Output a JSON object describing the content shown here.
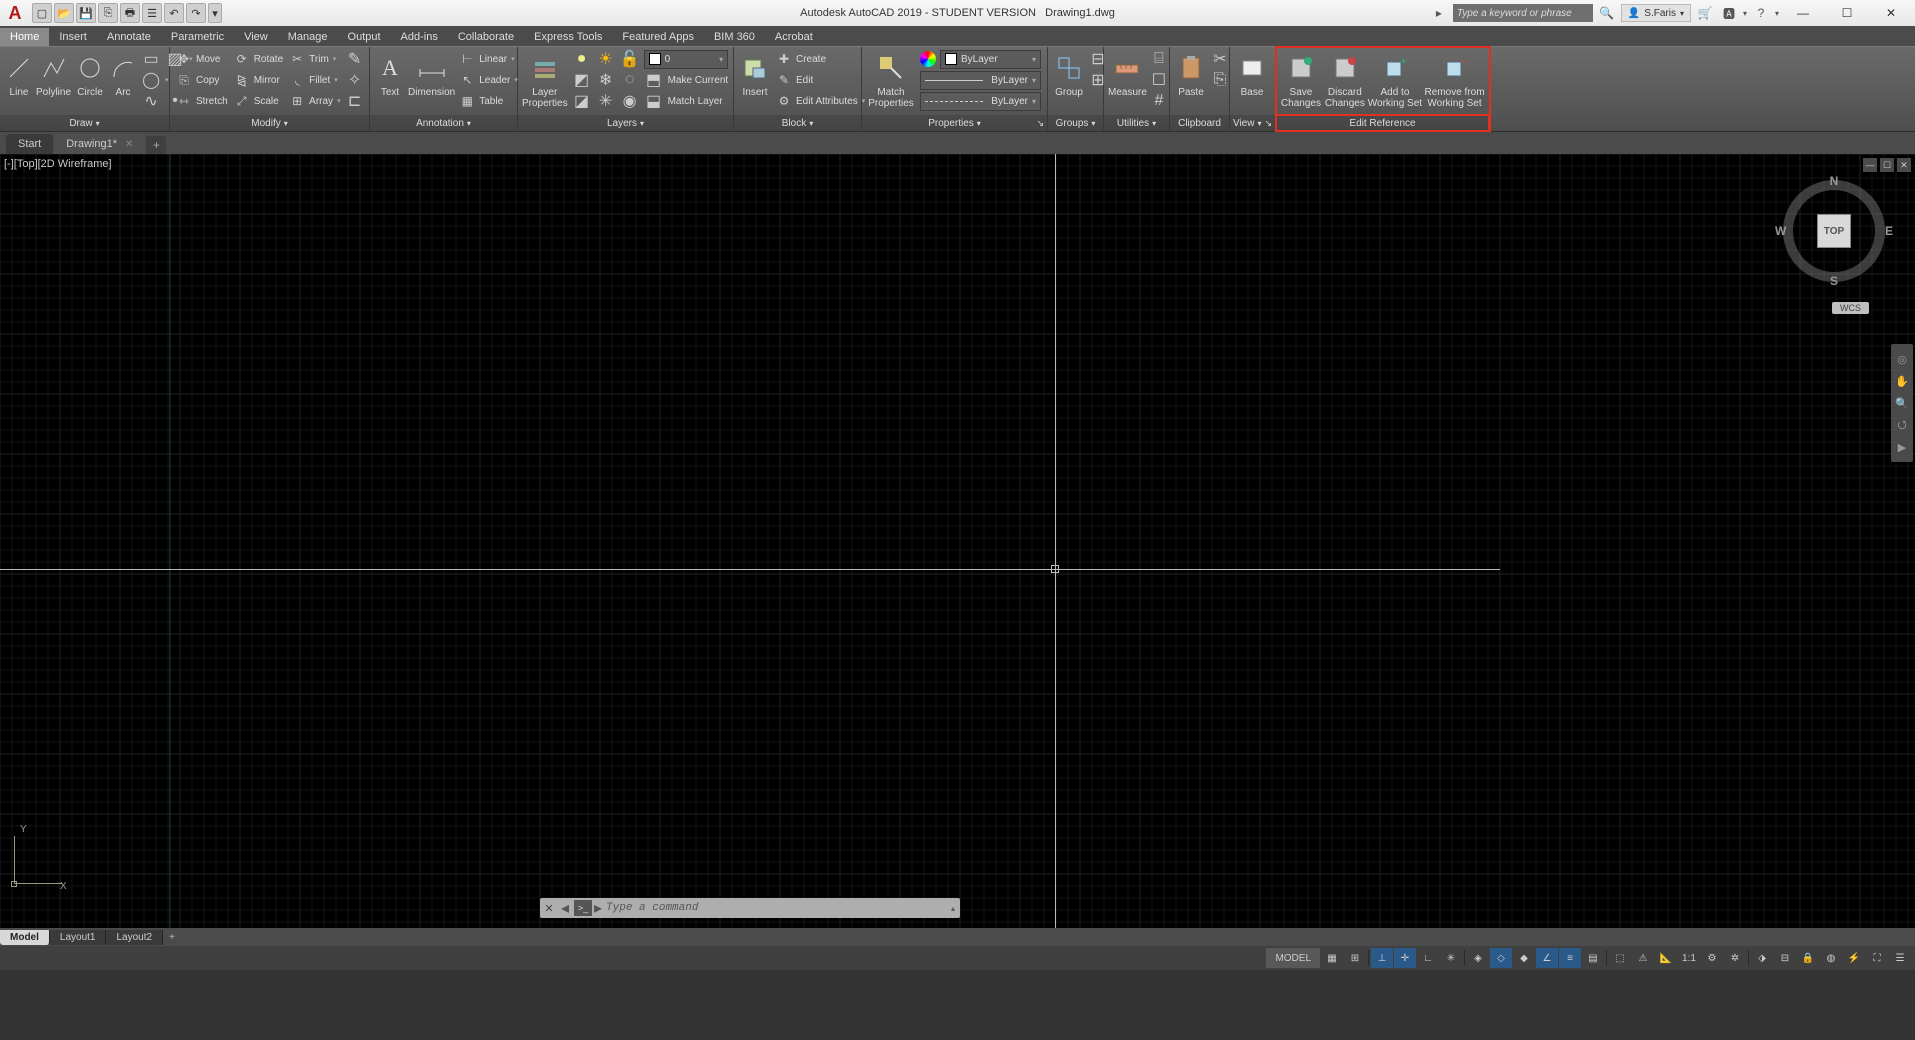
{
  "app": {
    "title_prefix": "Autodesk AutoCAD 2019 - STUDENT VERSION",
    "document": "Drawing1.dwg",
    "search_placeholder": "Type a keyword or phrase",
    "user": "S.Faris"
  },
  "qat_icons": [
    "new",
    "open",
    "save",
    "saveas",
    "plot",
    "undo",
    "redo"
  ],
  "menu_tabs": [
    "Home",
    "Insert",
    "Annotate",
    "Parametric",
    "View",
    "Manage",
    "Output",
    "Add-ins",
    "Collaborate",
    "Express Tools",
    "Featured Apps",
    "BIM 360",
    "Acrobat"
  ],
  "active_menu_tab": "Home",
  "file_tabs": [
    {
      "label": "Start",
      "dirty": false,
      "active": false
    },
    {
      "label": "Drawing1*",
      "dirty": true,
      "active": true
    }
  ],
  "ribbon": {
    "draw": {
      "title": "Draw",
      "big": [
        "Line",
        "Polyline",
        "Circle",
        "Arc"
      ]
    },
    "modify": {
      "title": "Modify",
      "rows": [
        {
          "icon": "move",
          "label": "Move"
        },
        {
          "icon": "copy",
          "label": "Copy"
        },
        {
          "icon": "stretch",
          "label": "Stretch"
        },
        {
          "icon": "rotate",
          "label": "Rotate"
        },
        {
          "icon": "mirror",
          "label": "Mirror"
        },
        {
          "icon": "scale",
          "label": "Scale"
        },
        {
          "icon": "trim",
          "label": "Trim"
        },
        {
          "icon": "fillet",
          "label": "Fillet"
        },
        {
          "icon": "array",
          "label": "Array"
        }
      ]
    },
    "annotation": {
      "title": "Annotation",
      "big": [
        "Text",
        "Dimension"
      ],
      "rows": [
        {
          "label": "Linear"
        },
        {
          "label": "Leader"
        },
        {
          "label": "Table"
        }
      ]
    },
    "layers": {
      "title": "Layers",
      "big": "Layer\nProperties",
      "current": "0",
      "rows": [
        {
          "label": "Make Current"
        },
        {
          "label": "Match Layer"
        }
      ]
    },
    "block": {
      "title": "Block",
      "big": "Insert",
      "rows": [
        {
          "label": "Create"
        },
        {
          "label": "Edit"
        },
        {
          "label": "Edit Attributes"
        }
      ]
    },
    "properties": {
      "title": "Properties",
      "big": "Match\nProperties",
      "combos": [
        "ByLayer",
        "ByLayer",
        "ByLayer"
      ]
    },
    "groups": {
      "title": "Groups",
      "big": "Group"
    },
    "utilities": {
      "title": "Utilities",
      "big": "Measure"
    },
    "clipboard": {
      "title": "Clipboard",
      "big": "Paste"
    },
    "view": {
      "title": "View",
      "big": "Base"
    },
    "editref": {
      "title": "Edit Reference",
      "items": [
        "Save\nChanges",
        "Discard\nChanges",
        "Add to\nWorking Set",
        "Remove from\nWorking Set"
      ]
    }
  },
  "viewport": {
    "label": "[-][Top][2D Wireframe]",
    "cube": "TOP",
    "wcs": "WCS",
    "compass": {
      "n": "N",
      "s": "S",
      "e": "E",
      "w": "W"
    }
  },
  "commandline": {
    "placeholder": "Type a command"
  },
  "ucs": {
    "x": "X",
    "y": "Y"
  },
  "layout_tabs": [
    "Model",
    "Layout1",
    "Layout2"
  ],
  "active_layout": "Model",
  "status": {
    "model": "MODEL",
    "scale": "1:1"
  }
}
